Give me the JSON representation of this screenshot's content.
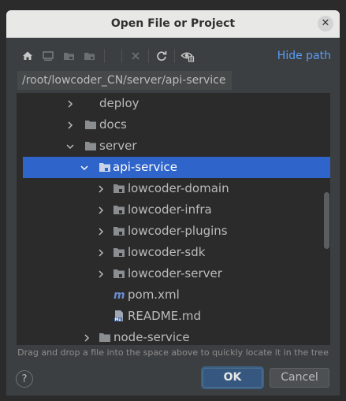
{
  "dialog": {
    "title": "Open File or Project",
    "close_glyph": "✕",
    "hide_path_label": "Hide path",
    "path_value": "/root/lowcoder_CN/server/api-service",
    "hint": "Drag and drop a file into the space above to quickly locate it in the tree",
    "help_glyph": "?",
    "ok_label": "OK",
    "cancel_label": "Cancel"
  },
  "toolbar": {
    "icons": [
      "home-icon",
      "desktop-icon",
      "project-folder-icon",
      "module-folder-icon",
      "delete-icon",
      "refresh-icon",
      "show-hidden-icon"
    ]
  },
  "tree": {
    "items": [
      {
        "label": "deploy",
        "type": "folder",
        "expanded": false
      },
      {
        "label": "docs",
        "type": "folder",
        "expanded": false
      },
      {
        "label": "server",
        "type": "folder",
        "expanded": true
      },
      {
        "label": "api-service",
        "type": "module-folder",
        "expanded": true,
        "selected": true
      },
      {
        "label": "lowcoder-domain",
        "type": "module-folder",
        "expanded": false
      },
      {
        "label": "lowcoder-infra",
        "type": "module-folder",
        "expanded": false
      },
      {
        "label": "lowcoder-plugins",
        "type": "module-folder",
        "expanded": false
      },
      {
        "label": "lowcoder-sdk",
        "type": "module-folder",
        "expanded": false
      },
      {
        "label": "lowcoder-server",
        "type": "module-folder",
        "expanded": false
      },
      {
        "label": "pom.xml",
        "type": "maven-file"
      },
      {
        "label": "README.md",
        "type": "markdown-file"
      },
      {
        "label": "node-service",
        "type": "folder",
        "expanded": false
      }
    ]
  },
  "colors": {
    "accent": "#589df6",
    "selection": "#2f65ca",
    "folder": "#8a8e91",
    "maven": "#6a8ccf"
  }
}
